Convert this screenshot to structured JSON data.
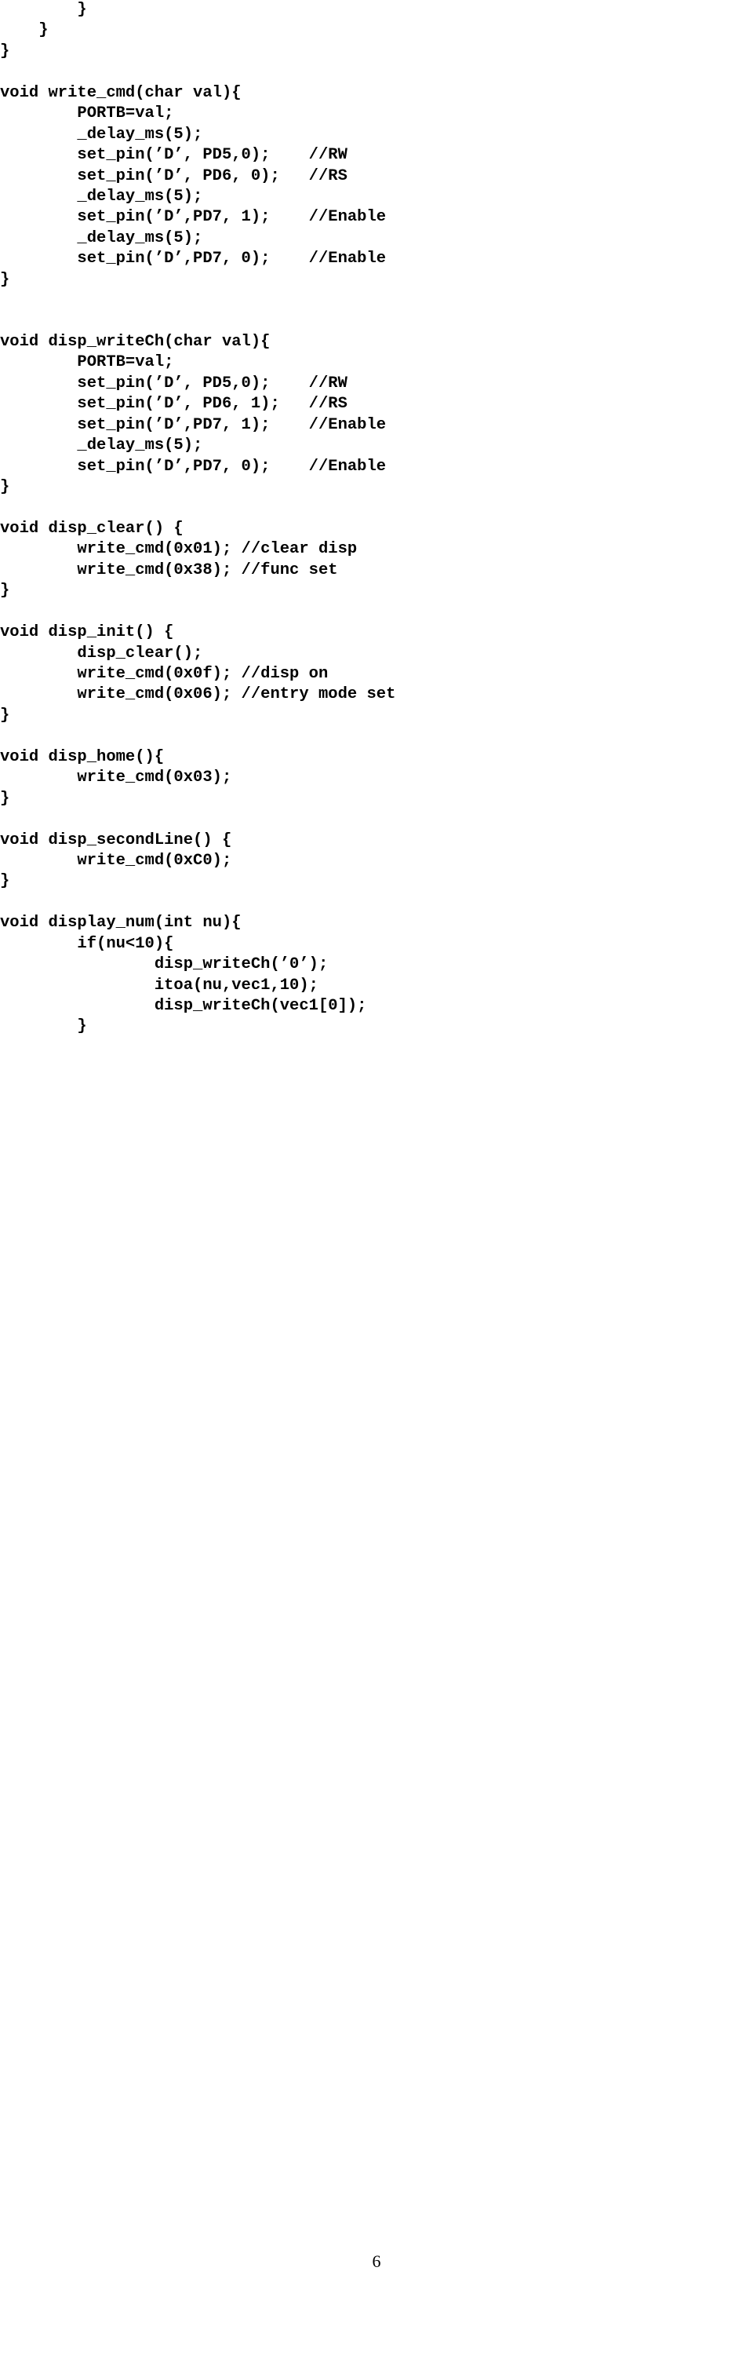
{
  "code_lines": [
    "        }",
    "    }",
    "}",
    "",
    "void write_cmd(char val){",
    "        PORTB=val;",
    "        _delay_ms(5);",
    "        set_pin('D', PD5,0);    //RW",
    "        set_pin('D', PD6, 0);   //RS",
    "        _delay_ms(5);",
    "        set_pin('D',PD7, 1);    //Enable",
    "        _delay_ms(5);",
    "        set_pin('D',PD7, 0);    //Enable",
    "}",
    "",
    "",
    "void disp_writeCh(char val){",
    "        PORTB=val;",
    "        set_pin('D', PD5,0);    //RW",
    "        set_pin('D', PD6, 1);   //RS",
    "        set_pin('D',PD7, 1);    //Enable",
    "        _delay_ms(5);",
    "        set_pin('D',PD7, 0);    //Enable",
    "}",
    "",
    "void disp_clear() {",
    "        write_cmd(0x01); //clear disp",
    "        write_cmd(0x38); //func set",
    "}",
    "",
    "void disp_init() {",
    "        disp_clear();",
    "        write_cmd(0x0f); //disp on",
    "        write_cmd(0x06); //entry mode set",
    "}",
    "",
    "void disp_home(){",
    "        write_cmd(0x03);",
    "}",
    "",
    "void disp_secondLine() {",
    "        write_cmd(0xC0);",
    "}",
    "",
    "void display_num(int nu){",
    "        if(nu<10){",
    "                disp_writeCh('0');",
    "                itoa(nu,vec1,10);",
    "                disp_writeCh(vec1[0]);",
    "        }"
  ],
  "page_number": "6"
}
